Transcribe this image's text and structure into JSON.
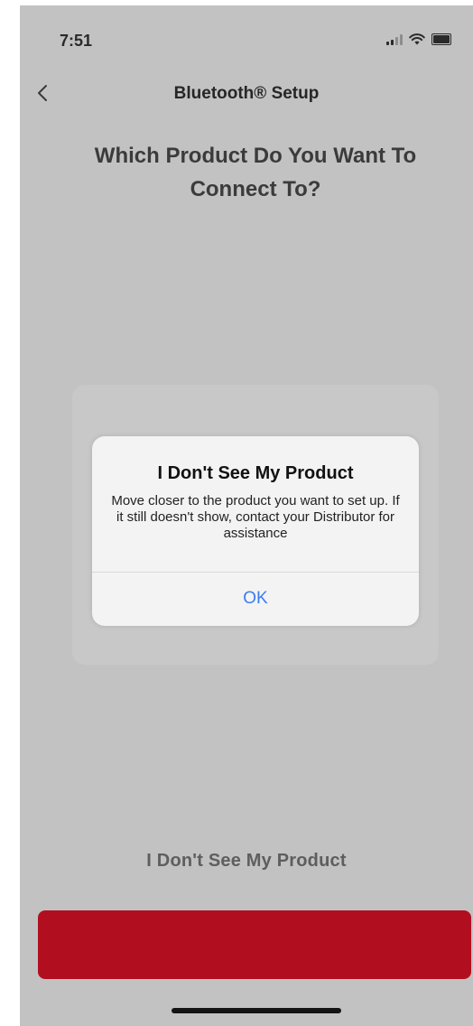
{
  "status_bar": {
    "time": "7:51",
    "signal_icon": "signal-icon",
    "wifi_icon": "wifi-icon",
    "battery_icon": "battery-icon"
  },
  "nav": {
    "back_icon": "chevron-left-icon",
    "title": "Bluetooth® Setup"
  },
  "page": {
    "question": "Which Product Do You Want To Connect To?",
    "no_product_link": "I Don't See My Product",
    "primary_button_label": ""
  },
  "dialog": {
    "title": "I Don't See My Product",
    "message": "Move closer to the product you want to set up. If it still doesn't show, contact your Distributor for assistance",
    "ok_label": "OK"
  },
  "colors": {
    "overlay_background": "#c2c2c2",
    "accent_red": "#b10f1f",
    "link_blue": "#3b7df0",
    "dialog_background": "#f3f3f3"
  }
}
